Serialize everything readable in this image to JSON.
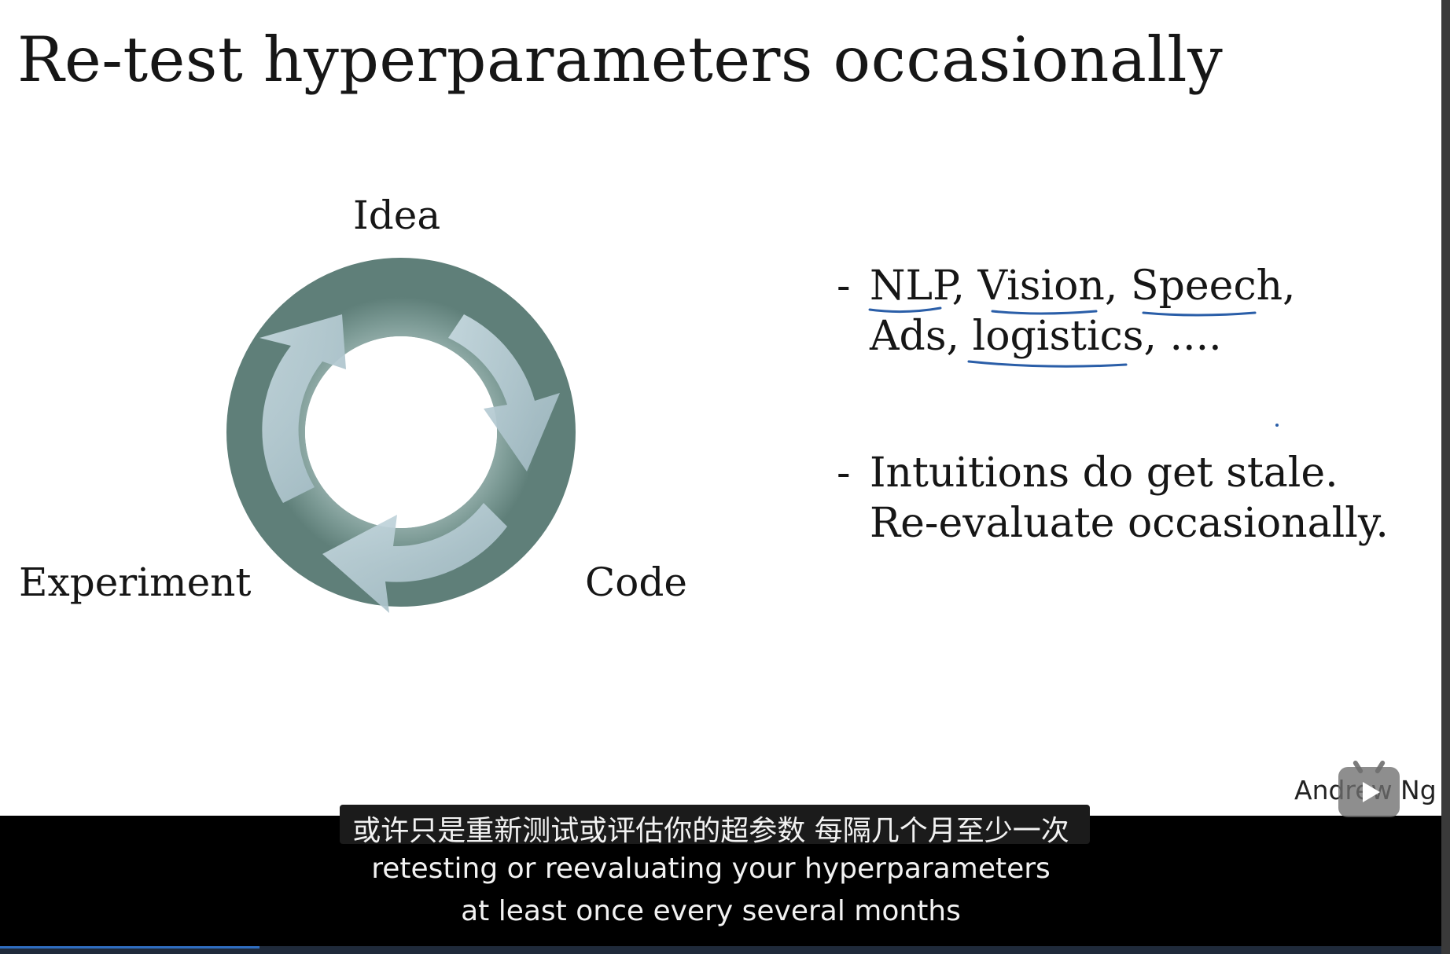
{
  "slide": {
    "title": "Re-test hyperparameters occasionally",
    "cycle": {
      "top_label": "Idea",
      "left_label": "Experiment",
      "right_label": "Code"
    },
    "bullets": [
      {
        "dash": "-",
        "lines": [
          "NLP, Vision, Speech,",
          "Ads, logistics, ...."
        ]
      },
      {
        "dash": "-",
        "lines": [
          "Intuitions do get stale.",
          "Re-evaluate occasionally."
        ]
      }
    ],
    "watermark": "Andrew Ng"
  },
  "subtitles": {
    "zh": "或许只是重新测试或评估你的超参数 每隔几个月至少一次",
    "en_line1": "retesting or reevaluating your hyperparameters",
    "en_line2": "at least once every several months"
  },
  "colors": {
    "ring_dark": "#6f8d86",
    "ring_light": "#b8cdd5",
    "ink_blue": "#2a5ea8",
    "subtitle_bg": "#000000",
    "progress": "#2f6ec1"
  },
  "player": {
    "play_icon": "play-icon",
    "progress_fraction": 0.18
  }
}
